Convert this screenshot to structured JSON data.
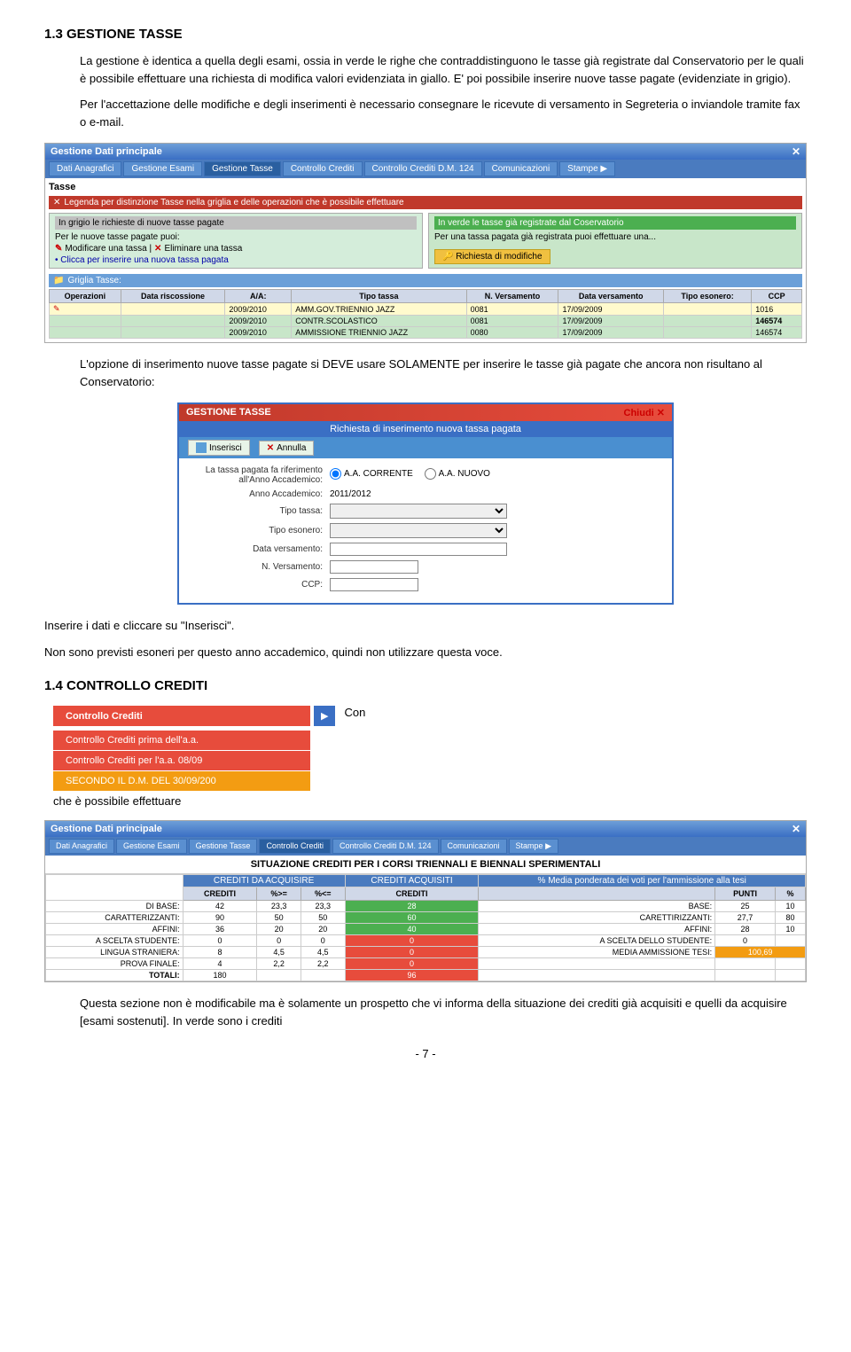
{
  "section_title": "1.3 GESTIONE TASSE",
  "section_para1": "La gestione è identica a quella degli esami, ossia in verde le righe che contraddistinguono le tasse già registrate dal Conservatorio per le quali è possibile effettuare una richiesta di modifica valori evidenziata in giallo. E' poi possibile inserire nuove tasse pagate (evidenziate in grigio).",
  "section_para2": "Per l'accettazione delle modifiche e degli inserimenti è necessario consegnare le ricevute di versamento in Segreteria o inviandole tramite fax o e-mail.",
  "win_title": "Gestione Dati principale",
  "nav_items": [
    "Dati Anagrafici",
    "Gestione Esami",
    "Gestione Tasse",
    "Controllo Crediti",
    "Controllo Crediti D.M. 124",
    "Comunicazioni",
    "Stampe"
  ],
  "tasse_section": "Tasse",
  "legenda_label": "Legenda per distinzione Tasse nella griglia e delle operazioni che è possibile effettuare",
  "legenda_left_title": "In grigio le richieste di nuove tasse pagate",
  "legenda_left_items": [
    "Modificare una tassa | Eliminare una tassa",
    "Clicca per inserire una nuova tassa pagata"
  ],
  "legenda_right_title": "In verde le tasse già registrate dal Coservatorio",
  "legenda_right_sub": "Per una tassa pagata già registrata puoi effettuare una...",
  "modifica_btn": "Richiesta di modifiche",
  "griglia_title": "Griglia Tasse:",
  "table_headers": [
    "Operazioni",
    "Data riscossione",
    "A/A:",
    "Tipo tassa",
    "N. Versamento",
    "Data versamento",
    "Tipo esonero:",
    "CCP"
  ],
  "table_rows": [
    {
      "col1": "",
      "col2": "",
      "col3": "2009/2010",
      "col4": "AMM.GOV.TRIENNIO JAZZ",
      "col5": "0081",
      "col6": "17/09/2009",
      "col7": "",
      "col8": "1016",
      "style": "yellow"
    },
    {
      "col1": "",
      "col2": "",
      "col3": "2009/2010",
      "col4": "CONTR.SCOLASTICO",
      "col5": "0081",
      "col6": "17/09/2009",
      "col7": "",
      "col8": "146574",
      "style": "green"
    },
    {
      "col1": "",
      "col2": "",
      "col3": "2009/2010",
      "col4": "AMMISSIONE TRIENNIO JAZZ",
      "col5": "0080",
      "col6": "17/09/2009",
      "col7": "",
      "col8": "146574",
      "style": "green"
    }
  ],
  "inserimento_para": "L'opzione di inserimento nuove tasse pagate si DEVE usare SOLAMENTE per inserire le tasse già pagate che ancora non risultano al Conservatorio:",
  "ins_win_title": "GESTIONE TASSE",
  "ins_header": "Richiesta di inserimento nuova tassa pagata",
  "ins_btn_inserisci": "Inserisci",
  "ins_btn_annulla": "Annulla",
  "ins_chiudi": "Chiudi",
  "ins_label1": "La tassa pagata fa riferimento all'Anno Accademico:",
  "ins_radio1": "A.A. CORRENTE",
  "ins_radio2": "A.A. NUOVO",
  "ins_label2": "Anno Accademico:",
  "ins_value2": "2011/2012",
  "ins_label3": "Tipo tassa:",
  "ins_label4": "Tipo esonero:",
  "ins_label5": "Data versamento:",
  "ins_label6": "N. Versamento:",
  "ins_label7": "CCP:",
  "ins_note1": "Inserire i dati e cliccare su \"Inserisci\".",
  "ins_note2": "Non sono previsti esoneri per questo anno accademico, quindi non utilizzare questa voce.",
  "section2_title": "1.4 CONTROLLO CREDITI",
  "btn_crediti": "Controllo Crediti",
  "btn_crediti_items": [
    "Controllo Crediti prima dell'a.a.",
    "Controllo Crediti per l'a.a. 08/09",
    "SECONDO IL D.M. DEL 30/09/200"
  ],
  "che_e_text": "che è possibile effettuare",
  "cred_win_title": "Gestione Dati principale",
  "cred_table_title": "SITUAZIONE CREDITI PER I CORSI TRIENNALI E BIENNALI SPERIMENTALI",
  "cred_nav_items": [
    "Dati Anagrafici",
    "Gestione Esami",
    "Gestione Tasse",
    "Controllo Crediti",
    "Controllo Crediti D.M. 124",
    "Comunicazioni",
    "Stampe"
  ],
  "cred_col_headers1": [
    "CREDITI DA ACQUISIRE",
    "",
    "",
    "CREDITI ACQUISITI",
    "% Media ponderata dei voti per l'ammissione alla tesi"
  ],
  "cred_col_headers2": [
    "",
    "CREDITI",
    "%>=",
    "%<=",
    "CREDITI",
    "",
    "PUNTI",
    "%"
  ],
  "cred_rows": [
    {
      "label": "DI BASE:",
      "c1": "42",
      "c2": "23,3",
      "c3": "23,3",
      "c4_green": "28",
      "right_label": "BASE:",
      "r1": "25",
      "r2": "10"
    },
    {
      "label": "CARATTERIZZANTI:",
      "c1": "90",
      "c2": "50",
      "c3": "50",
      "c4_green": "60",
      "right_label": "CARETTIRIZZANTI:",
      "r1": "27,7",
      "r2": "80"
    },
    {
      "label": "AFFINI:",
      "c1": "36",
      "c2": "20",
      "c3": "20",
      "c4_green": "40",
      "right_label": "AFFINI:",
      "r1": "28",
      "r2": "10"
    },
    {
      "label": "A SCELTA STUDENTE:",
      "c1": "0",
      "c2": "0",
      "c3": "0",
      "c4_red": "0",
      "right_label": "A SCELTA DELLO STUDENTE:",
      "r1": "0",
      "r2": ""
    },
    {
      "label": "LINGUA STRANIERA:",
      "c1": "8",
      "c2": "4,5",
      "c3": "4,5",
      "c4_red": "0",
      "right_label": "MEDIA AMMISSIONE TESI:",
      "r1": "100,69",
      "r2": ""
    },
    {
      "label": "PROVA FINALE:",
      "c1": "4",
      "c2": "2,2",
      "c3": "2,2",
      "c4_red": "0",
      "right_label": "",
      "r1": "",
      "r2": ""
    },
    {
      "label": "TOTALI:",
      "c1": "180",
      "c2": "",
      "c3": "",
      "c4_red": "96",
      "right_label": "",
      "r1": "",
      "r2": ""
    }
  ],
  "section2_para": "Questa sezione non è modificabile ma è solamente un prospetto che vi informa della situazione dei crediti già acquisiti e quelli da acquisire [esami sostenuti]. In verde sono i crediti",
  "page_number": "- 7 -"
}
